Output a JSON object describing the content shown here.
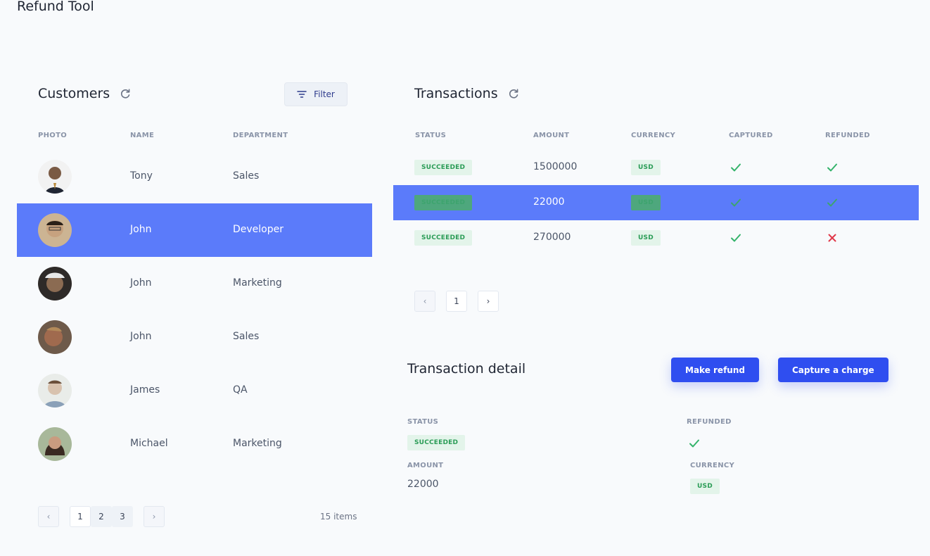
{
  "app": {
    "title": "Refund Tool"
  },
  "customers": {
    "title": "Customers",
    "filter_label": "Filter",
    "columns": [
      "PHOTO",
      "NAME",
      "DEPARTMENT"
    ],
    "rows": [
      {
        "name": "Tony",
        "department": "Sales",
        "avatar_color": "#7a5a44"
      },
      {
        "name": "John",
        "department": "Developer",
        "avatar_color": "#c7a27f"
      },
      {
        "name": "John",
        "department": "Marketing",
        "avatar_color": "#8b6b52"
      },
      {
        "name": "John",
        "department": "Sales",
        "avatar_color": "#a06a4e"
      },
      {
        "name": "James",
        "department": "QA",
        "avatar_color": "#d8c2ae"
      },
      {
        "name": "Michael",
        "department": "Marketing",
        "avatar_color": "#5d463a"
      }
    ],
    "pagination": {
      "prev": "‹",
      "pages": [
        "1",
        "2",
        "3"
      ],
      "next": "›",
      "items": "15 items"
    }
  },
  "transactions": {
    "title": "Transactions",
    "columns": [
      "STATUS",
      "AMOUNT",
      "CURRENCY",
      "CAPTURED",
      "REFUNDED"
    ],
    "rows": [
      {
        "status": "SUCCEEDED",
        "amount": "1500000",
        "currency": "USD",
        "captured": true,
        "refunded": true
      },
      {
        "status": "SUCCEEDED",
        "amount": "22000",
        "currency": "USD",
        "captured": true,
        "refunded": true
      },
      {
        "status": "SUCCEEDED",
        "amount": "270000",
        "currency": "USD",
        "captured": true,
        "refunded": false
      }
    ],
    "pagination": {
      "prev": "‹",
      "pages": [
        "1"
      ],
      "next": "›"
    }
  },
  "detail": {
    "title": "Transaction detail",
    "make_refund_label": "Make refund",
    "capture_label": "Capture a charge",
    "status_label": "STATUS",
    "status_value": "SUCCEEDED",
    "refunded_label": "REFUNDED",
    "refunded_value": true,
    "amount_label": "AMOUNT",
    "amount_value": "22000",
    "currency_label": "CURRENCY",
    "currency_value": "USD"
  },
  "colors": {
    "accent": "#5b7bfa",
    "primary_button": "#2f4ef0",
    "success": "#34b36b",
    "danger": "#e0394a"
  }
}
